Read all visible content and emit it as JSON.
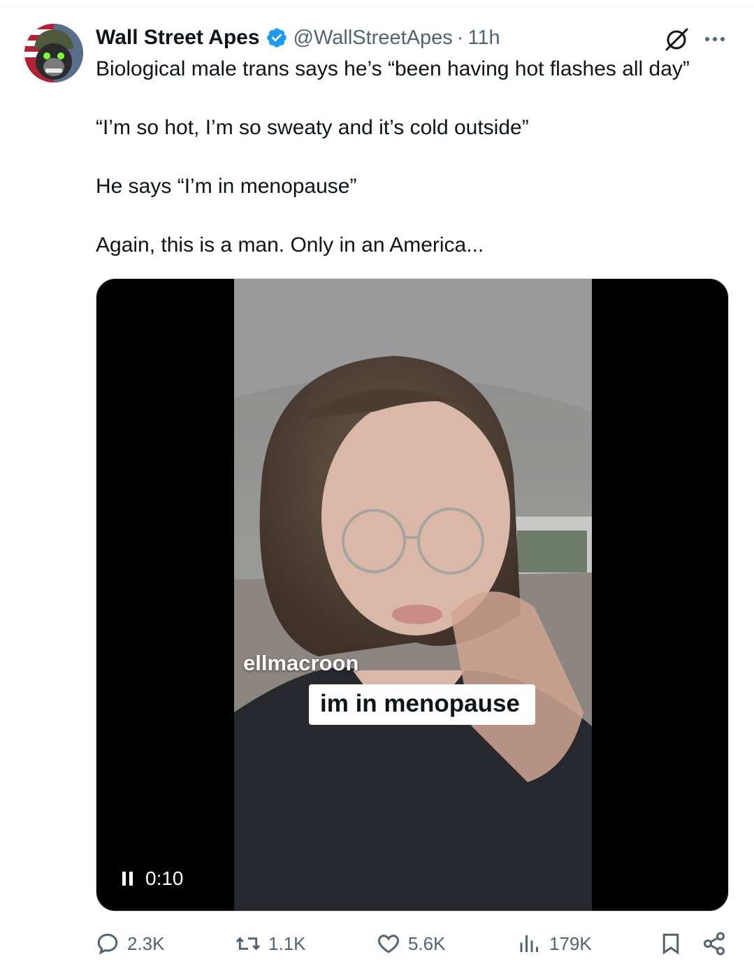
{
  "author": {
    "display_name": "Wall Street Apes",
    "handle": "@WallStreetApes",
    "separator": "·",
    "time_ago": "11h",
    "verified_color": "#1d9bf0"
  },
  "tweet": {
    "paragraphs": [
      "Biological male trans says he’s “been having hot flashes all day”",
      "“I’m so hot, I’m so sweaty and it’s cold outside”",
      "He says “I’m in menopause”",
      "Again, this is a man. Only in an America..."
    ]
  },
  "video": {
    "overlay_username": "ellmacroon",
    "caption": "im in menopause",
    "timecode": "0:10",
    "state_icon": "pause-icon"
  },
  "actions": {
    "replies": "2.3K",
    "reposts": "1.1K",
    "likes": "5.6K",
    "views": "179K"
  },
  "colors": {
    "text": "#0f1419",
    "muted": "#536471",
    "accent": "#1d9bf0"
  }
}
